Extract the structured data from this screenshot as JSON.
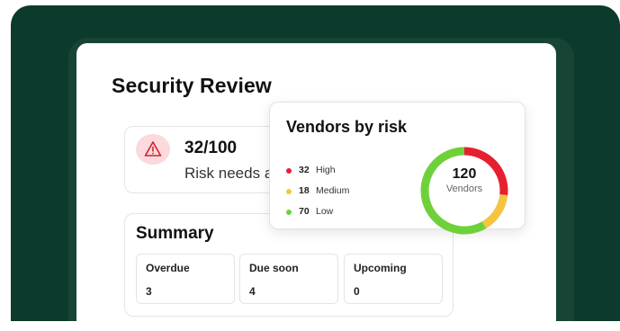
{
  "page": {
    "title": "Security Review"
  },
  "score": {
    "value": "32/100",
    "note": "Risk needs attention",
    "icon": "alert-triangle-icon"
  },
  "summary": {
    "title": "Summary",
    "stats": [
      {
        "label": "Overdue",
        "value": "3"
      },
      {
        "label": "Due soon",
        "value": "4"
      },
      {
        "label": "Upcoming",
        "value": "0"
      }
    ]
  },
  "vendors": {
    "title": "Vendors by risk",
    "total": "120",
    "total_label": "Vendors",
    "items": [
      {
        "count": "32",
        "label": "High",
        "color": "#e5202f"
      },
      {
        "count": "18",
        "label": "Medium",
        "color": "#f5c542"
      },
      {
        "count": "70",
        "label": "Low",
        "color": "#6fd13a"
      }
    ]
  },
  "colors": {
    "background": "#0c3a2c",
    "alert_bg": "#fbd9dc",
    "alert_stroke": "#d1222d"
  }
}
